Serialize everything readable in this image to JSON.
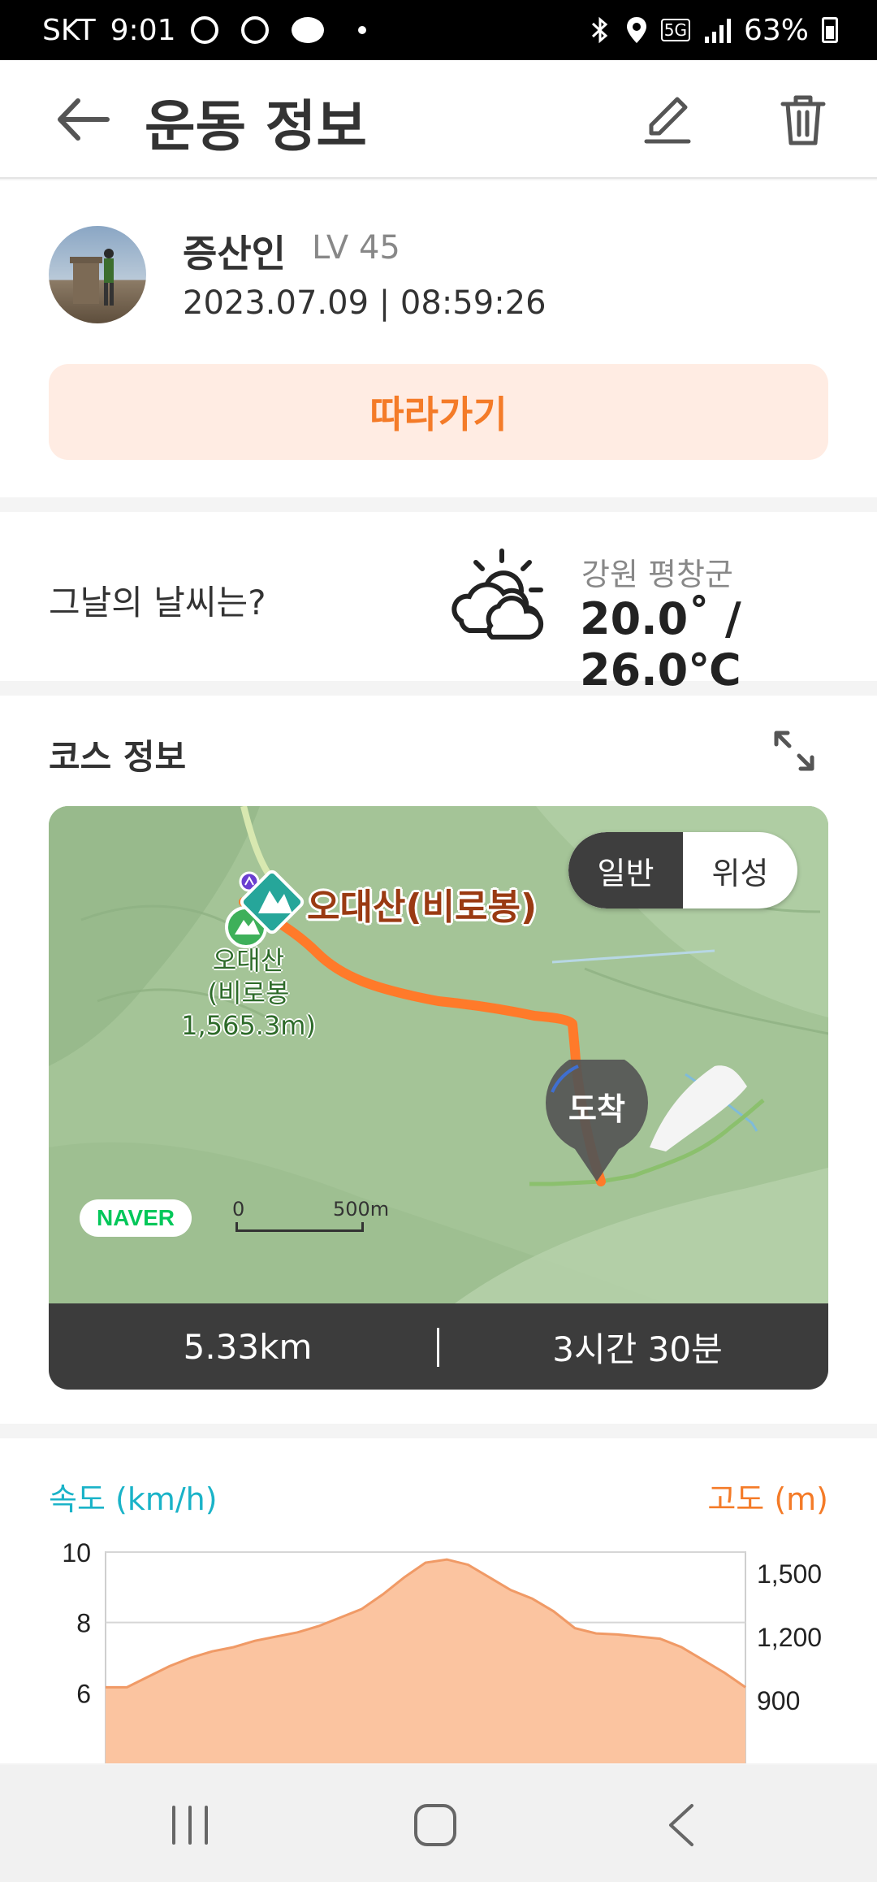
{
  "status_bar": {
    "carrier": "SKT",
    "time": "9:01",
    "network": "5G",
    "battery": "63%"
  },
  "header": {
    "title": "운동 정보"
  },
  "profile": {
    "username": "증산인",
    "level": "LV 45",
    "datetime": "2023.07.09 | 08:59:26",
    "follow_label": "따라가기"
  },
  "weather": {
    "label": "그날의 날씨는?",
    "region": "강원 평창군",
    "temperature": "20.0˚ / 26.0℃"
  },
  "course": {
    "title": "코스 정보",
    "map": {
      "toggle_standard": "일반",
      "toggle_satellite": "위성",
      "peak_label": "오대산(비로봉)",
      "peak_name_line1": "오대산",
      "peak_name_line2": "(비로봉1,565.3m)",
      "arrival_label": "도착",
      "map_provider": "NAVER",
      "scale_zero": "0",
      "scale_distance": "500m"
    },
    "distance": "5.33km",
    "duration": "3시간 30분"
  },
  "graph": {
    "speed_label": "속도 (km/h)",
    "altitude_label": "고도 (m)"
  },
  "chart_data": {
    "type": "area",
    "series": [
      {
        "name": "고도 (m)",
        "values": [
          960,
          960,
          1010,
          1060,
          1100,
          1130,
          1150,
          1180,
          1200,
          1220,
          1250,
          1290,
          1330,
          1400,
          1480,
          1550,
          1565,
          1540,
          1480,
          1420,
          1380,
          1320,
          1240,
          1215,
          1210,
          1200,
          1190,
          1150,
          1090,
          1030,
          960
        ]
      }
    ],
    "y_left": {
      "label": "속도 (km/h)",
      "ticks": [
        6,
        8,
        10
      ],
      "range": [
        4,
        10
      ]
    },
    "y_right": {
      "label": "고도 (m)",
      "ticks": [
        "900",
        "1,200",
        "1,500"
      ],
      "range": [
        600,
        1600
      ]
    },
    "grid": true,
    "colors": {
      "fill": "#fbc4a0",
      "stroke": "#f09a66",
      "speed_axis": "#1ab3c8",
      "altitude_axis": "#f47b28"
    }
  },
  "colors": {
    "accent": "#f47b28",
    "accent_bg": "#ffece3",
    "dark_bar": "#3c3c3c",
    "route": "#ff7a2a"
  },
  "nav": {
    "icons": [
      "recent-apps-icon",
      "home-icon",
      "back-icon"
    ]
  }
}
